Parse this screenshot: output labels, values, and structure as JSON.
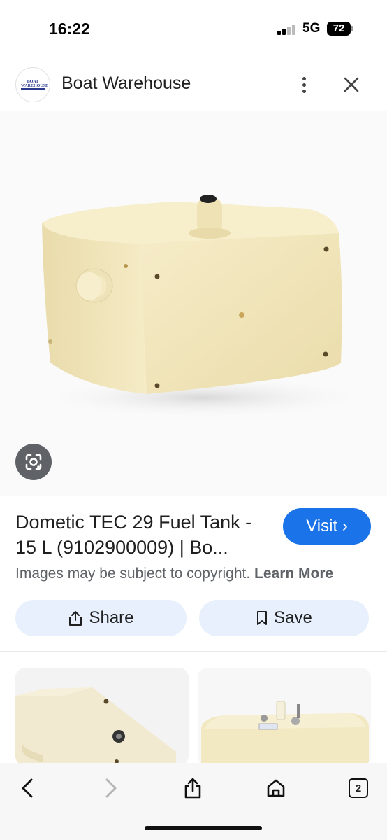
{
  "status": {
    "time": "16:22",
    "network": "5G",
    "battery": "72"
  },
  "site": {
    "name": "Boat Warehouse",
    "logo_text": "BOAT WAREHOUSE"
  },
  "icons": {
    "more": "more-vert-icon",
    "close": "close-icon",
    "lens": "google-lens-icon",
    "share": "share-icon",
    "save": "bookmark-icon",
    "back": "chevron-left-icon",
    "forward": "chevron-right-icon",
    "home": "home-icon",
    "tabs": "tabs-icon"
  },
  "result": {
    "title": "Dometic TEC 29 Fuel Tank - 15 L (9102900009) | Bo...",
    "visit_label": "Visit ›",
    "copyright_text": "Images may be subject to copyright.",
    "learn_more": "Learn More"
  },
  "actions": {
    "share_label": "Share",
    "save_label": "Save"
  },
  "bottom_nav": {
    "tabs_count": "2"
  },
  "colors": {
    "accent": "#1a73e8",
    "pill_bg": "#e8f0fe",
    "tank": "#f1e6bf"
  }
}
